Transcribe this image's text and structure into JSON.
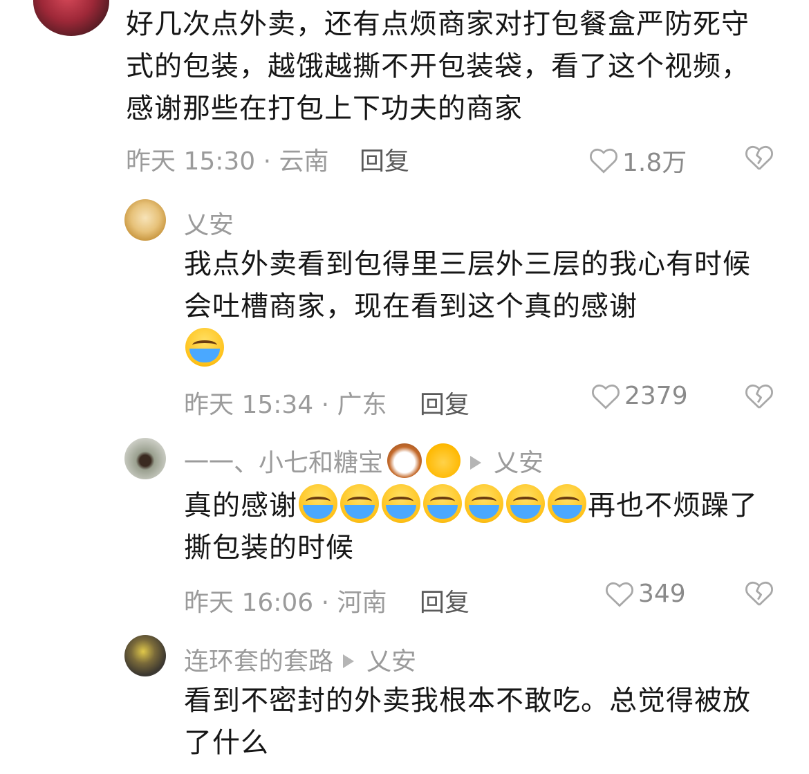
{
  "top_comment": {
    "text": "好几次点外卖，还有点烦商家对打包餐盒严防死守式的包装，越饿越撕不开包装袋，看了这个视频，感谢那些在打包上下功夫的商家",
    "meta": "昨天 15:30 · 云南",
    "reply_label": "回复",
    "likes": "1.8万"
  },
  "replies": [
    {
      "author": "乂安",
      "reply_to": "",
      "text": "我点外卖看到包得里三层外三层的我心有时候会吐槽商家，现在看到这个真的感谢",
      "emoji_after_text": [
        "loudly-crying-face"
      ],
      "meta": "昨天 15:34 · 广东",
      "reply_label": "回复",
      "likes": "2379"
    },
    {
      "author": "一一、小七和糖宝",
      "author_emojis": [
        "dog-face",
        "cat-face"
      ],
      "reply_to": "乂安",
      "text_before": "真的感谢",
      "emoji_run": [
        "loudly-crying-face",
        "loudly-crying-face",
        "loudly-crying-face",
        "loudly-crying-face",
        "loudly-crying-face",
        "loudly-crying-face",
        "loudly-crying-face"
      ],
      "text_after": "再也不烦躁了撕包装的时候",
      "meta": "昨天 16:06 · 河南",
      "reply_label": "回复",
      "likes": "349"
    },
    {
      "author": "连环套的套路",
      "reply_to": "乂安",
      "text": "看到不密封的外卖我根本不敢吃。总觉得被放了什么"
    }
  ],
  "icons": {
    "like": "heart-outline-icon",
    "dislike": "broken-heart-outline-icon"
  },
  "colors": {
    "text": "#161616",
    "meta": "#9b9b9b",
    "reply": "#5a5a5a",
    "icon": "#a8a8a8"
  }
}
